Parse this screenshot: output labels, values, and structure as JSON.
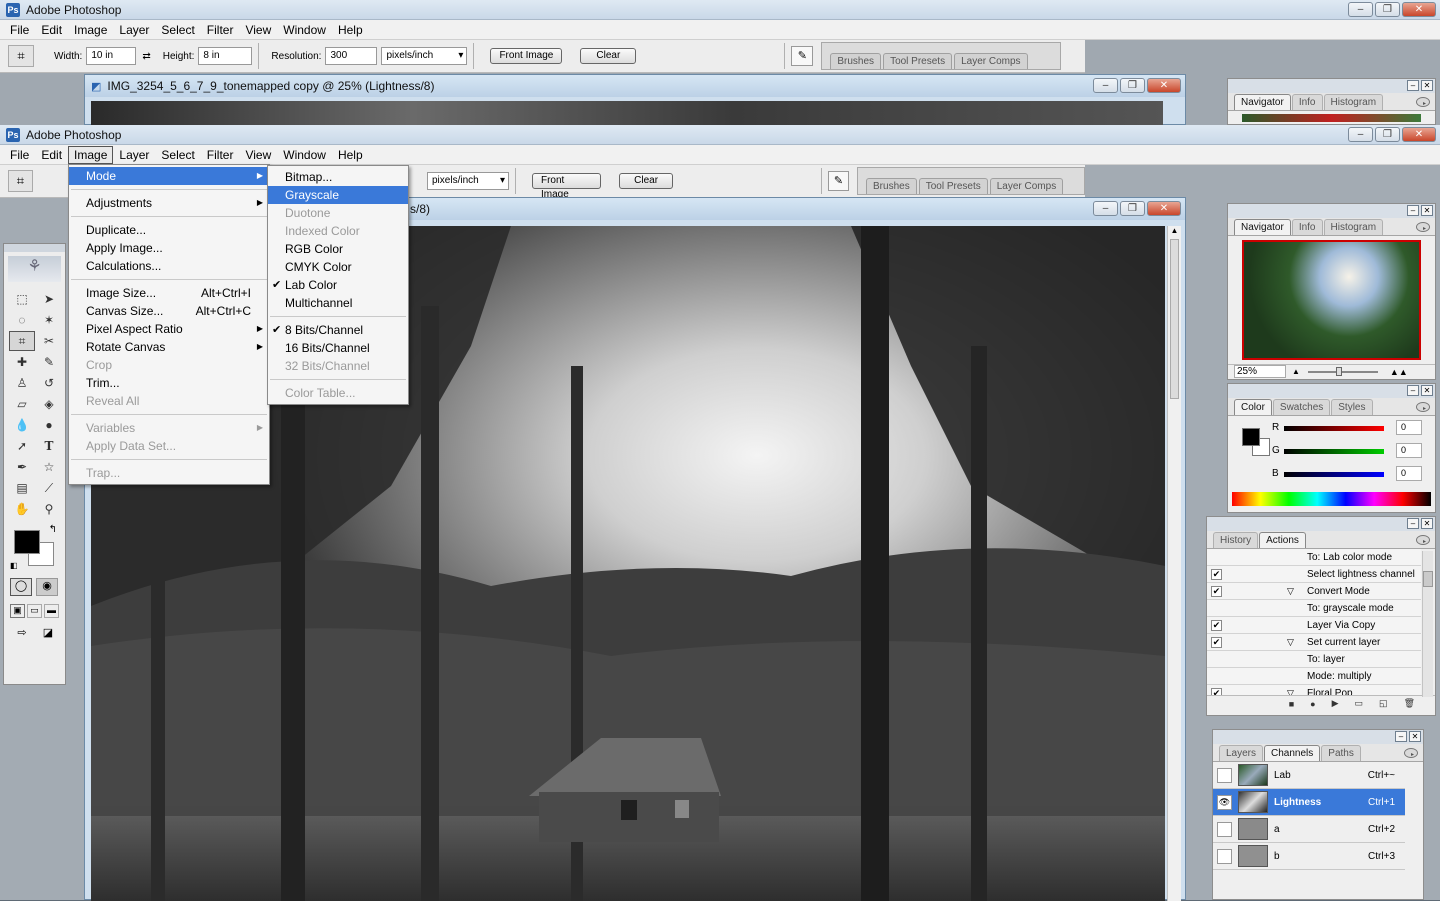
{
  "app_title": "Adobe Photoshop",
  "menubar": [
    "File",
    "Edit",
    "Image",
    "Layer",
    "Select",
    "Filter",
    "View",
    "Window",
    "Help"
  ],
  "options": {
    "width_label": "Width:",
    "width_value": "10 in",
    "height_label": "Height:",
    "height_value": "8 in",
    "resolution_label": "Resolution:",
    "resolution_value": "300",
    "units": "pixels/inch",
    "front_image": "Front Image",
    "clear": "Clear"
  },
  "well_tabs": [
    "Brushes",
    "Tool Presets",
    "Layer Comps"
  ],
  "document": {
    "title": "IMG_3254_5_6_7_9_tonemapped copy @ 25% (Lightness/8)",
    "title_partial": "s/8)"
  },
  "image_menu": {
    "items": [
      {
        "label": "Mode",
        "sub": true,
        "hl": true
      },
      {
        "sep": true
      },
      {
        "label": "Adjustments",
        "sub": true
      },
      {
        "sep": true
      },
      {
        "label": "Duplicate..."
      },
      {
        "label": "Apply Image..."
      },
      {
        "label": "Calculations..."
      },
      {
        "sep": true
      },
      {
        "label": "Image Size...",
        "shortcut": "Alt+Ctrl+I"
      },
      {
        "label": "Canvas Size...",
        "shortcut": "Alt+Ctrl+C"
      },
      {
        "label": "Pixel Aspect Ratio",
        "sub": true
      },
      {
        "label": "Rotate Canvas",
        "sub": true
      },
      {
        "label": "Crop",
        "dis": true
      },
      {
        "label": "Trim..."
      },
      {
        "label": "Reveal All",
        "dis": true
      },
      {
        "sep": true
      },
      {
        "label": "Variables",
        "sub": true,
        "dis": true
      },
      {
        "label": "Apply Data Set...",
        "dis": true
      },
      {
        "sep": true
      },
      {
        "label": "Trap...",
        "dis": true
      }
    ]
  },
  "mode_menu": {
    "items": [
      {
        "label": "Bitmap..."
      },
      {
        "label": "Grayscale",
        "hl": true
      },
      {
        "label": "Duotone",
        "dis": true
      },
      {
        "label": "Indexed Color",
        "dis": true
      },
      {
        "label": "RGB Color"
      },
      {
        "label": "CMYK Color"
      },
      {
        "label": "Lab Color",
        "checked": true
      },
      {
        "label": "Multichannel"
      },
      {
        "sep": true
      },
      {
        "label": "8 Bits/Channel",
        "checked": true
      },
      {
        "label": "16 Bits/Channel"
      },
      {
        "label": "32 Bits/Channel",
        "dis": true
      },
      {
        "sep": true
      },
      {
        "label": "Color Table...",
        "dis": true
      }
    ]
  },
  "navigator": {
    "tabs": [
      "Navigator",
      "Info",
      "Histogram"
    ],
    "zoom": "25%"
  },
  "color_panel": {
    "tabs": [
      "Color",
      "Swatches",
      "Styles"
    ],
    "r_label": "R",
    "g_label": "G",
    "b_label": "B",
    "r": "0",
    "g": "0",
    "b": "0"
  },
  "history": {
    "tabs": [
      "History",
      "Actions"
    ],
    "rows": [
      {
        "label": "To: Lab color mode",
        "check": false
      },
      {
        "label": "Select lightness channel",
        "check": true
      },
      {
        "label": "Convert Mode",
        "check": true,
        "tri": true
      },
      {
        "label": "To: grayscale mode",
        "check": false
      },
      {
        "label": "Layer Via Copy",
        "check": true
      },
      {
        "label": "Set current layer",
        "check": true,
        "tri": true
      },
      {
        "label": "To: layer",
        "check": false
      },
      {
        "label": "Mode: multiply",
        "check": false
      },
      {
        "label": "Floral Pop",
        "check": true,
        "tri": true
      }
    ]
  },
  "channels": {
    "tabs": [
      "Layers",
      "Channels",
      "Paths"
    ],
    "rows": [
      {
        "name": "Lab",
        "shortcut": "Ctrl+~",
        "selected": false
      },
      {
        "name": "Lightness",
        "shortcut": "Ctrl+1",
        "selected": true
      },
      {
        "name": "a",
        "shortcut": "Ctrl+2",
        "selected": false
      },
      {
        "name": "b",
        "shortcut": "Ctrl+3",
        "selected": false
      }
    ]
  },
  "colors": {
    "menu_highlight": "#3a79d9",
    "accent": "#2a64b0"
  }
}
